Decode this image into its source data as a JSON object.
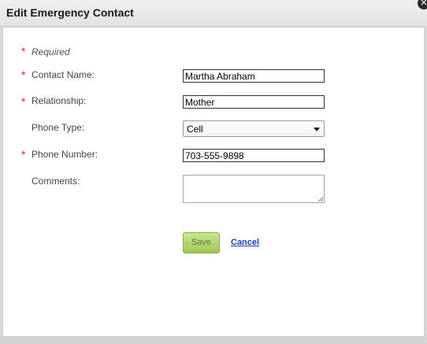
{
  "dialog": {
    "title": "Edit Emergency Contact",
    "close_glyph": "✕"
  },
  "form": {
    "asterisk": "*",
    "required_note": "Required",
    "contact_name": {
      "label": "Contact Name:",
      "value": "Martha Abraham",
      "required": true
    },
    "relationship": {
      "label": "Relationship:",
      "value": "Mother",
      "required": true
    },
    "phone_type": {
      "label": "Phone Type:",
      "value": "Cell",
      "required": false
    },
    "phone_number": {
      "label": "Phone Number:",
      "value": "703-555-9898",
      "required": true
    },
    "comments": {
      "label": "Comments:",
      "value": "",
      "required": false
    }
  },
  "actions": {
    "save_label": "Save",
    "cancel_label": "Cancel"
  },
  "colors": {
    "required_asterisk": "#d22b2b",
    "save_button": "#b5d873",
    "cancel_link": "#1a3fb8"
  },
  "icons": {
    "close": "close-icon",
    "dropdown": "chevron-down-icon",
    "resize": "resize-grip-icon"
  }
}
